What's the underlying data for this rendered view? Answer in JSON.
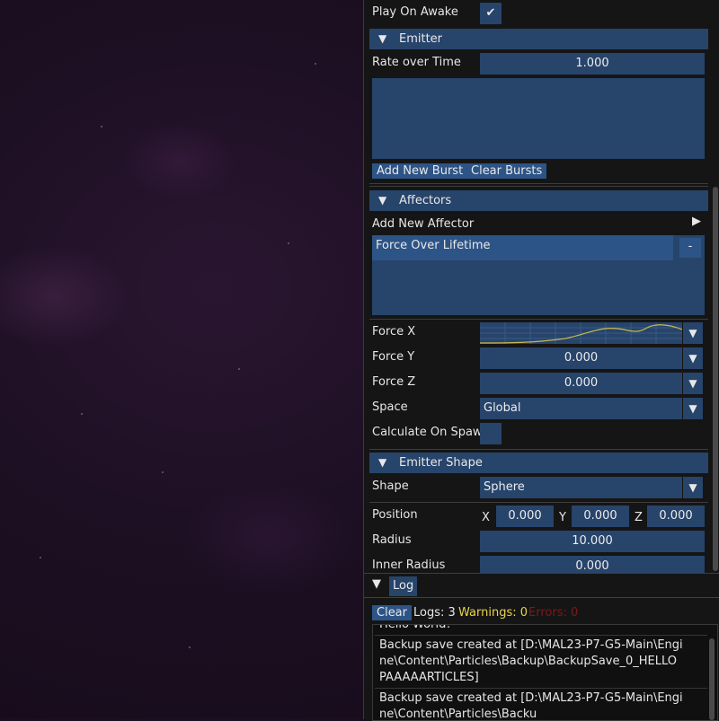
{
  "inspector": {
    "play_on_awake_label": "Play On Awake",
    "emitter": {
      "header": "Emitter",
      "rate_label": "Rate over Time",
      "rate_value": "1.000",
      "add_burst": "Add New Burst",
      "clear_bursts": "Clear Bursts"
    },
    "affectors": {
      "header": "Affectors",
      "add_label": "Add New Affector",
      "selected_item": "Force Over Lifetime",
      "remove_label": "-",
      "force_x_label": "Force X",
      "force_y_label": "Force Y",
      "force_y_value": "0.000",
      "force_z_label": "Force Z",
      "force_z_value": "0.000",
      "space_label": "Space",
      "space_value": "Global",
      "calc_spawn_label": "Calculate On Spawn"
    },
    "emitter_shape": {
      "header": "Emitter Shape",
      "shape_label": "Shape",
      "shape_value": "Sphere",
      "position_label": "Position",
      "x_label": "X",
      "x_value": "0.000",
      "y_label": "Y",
      "y_value": "0.000",
      "z_label": "Z",
      "z_value": "0.000",
      "radius_label": "Radius",
      "radius_value": "10.000",
      "inner_radius_label": "Inner Radius",
      "inner_radius_value": "0.000"
    }
  },
  "log": {
    "tab": "Log",
    "clear": "Clear",
    "logs_count": "Logs: 3",
    "warnings_count": "Warnings: 0",
    "errors_count": "Errors: 0",
    "entries": [
      "Hello World!",
      "Backup save created at [D:\\MAL23-P7-G5-Main\\Engine\\Content\\Particles\\Backup\\BackupSave_0_HELLO PAAAAARTICLES]",
      "Backup save created at [D:\\MAL23-P7-G5-Main\\Engine\\Content\\Particles\\Backu"
    ]
  },
  "colors": {
    "accent": "#27446b",
    "button": "#2d5486",
    "warning": "#e8d44d",
    "error": "#7a1a1a",
    "curve": "#c8b850"
  },
  "icons": {
    "collapse": "triangle-down-icon",
    "expand": "triangle-right-icon",
    "check": "checkmark-icon",
    "dropdown": "dropdown-arrow-icon"
  }
}
